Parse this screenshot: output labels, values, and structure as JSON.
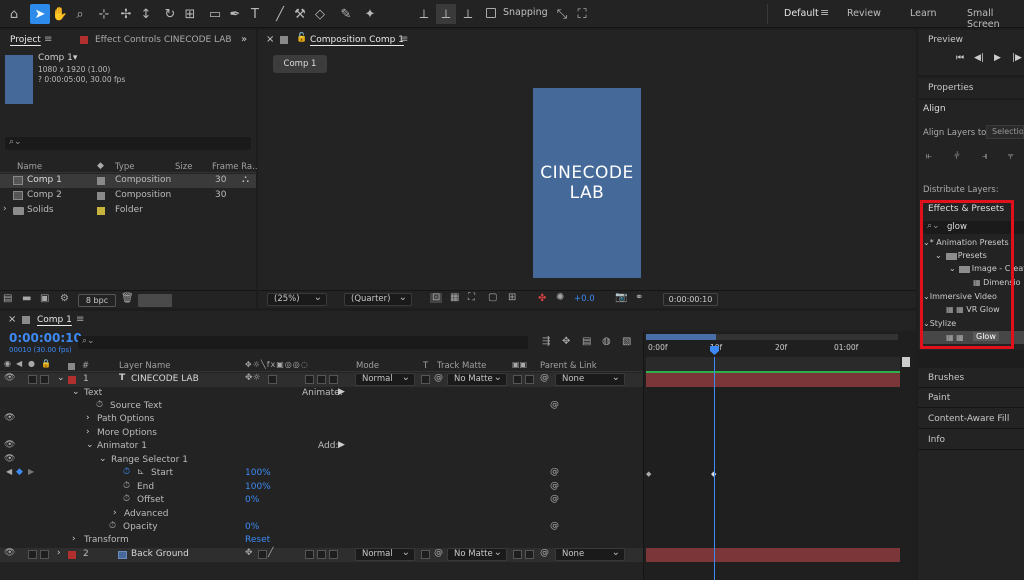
{
  "toolbar": {
    "snapping_label": "Snapping",
    "workspaces": [
      "Default",
      "Review",
      "Learn",
      "Small Screen"
    ]
  },
  "project": {
    "tab_project": "Project",
    "tab_effect_controls": "Effect Controls CINECODE LAB",
    "comp_name": "Comp 1",
    "comp_size": "1080 x 1920 (1.00)",
    "comp_duration": "? 0:00:05:00, 30.00 fps",
    "columns": {
      "name": "Name",
      "type": "Type",
      "size": "Size",
      "frame_rate": "Frame Ra..."
    },
    "items": [
      {
        "name": "Comp 1",
        "type": "Composition",
        "size": "",
        "frame_rate": "30",
        "label_color": "#8a8a8a"
      },
      {
        "name": "Comp 2",
        "type": "Composition",
        "size": "",
        "frame_rate": "30",
        "label_color": "#8a8a8a"
      },
      {
        "name": "Solids",
        "type": "Folder",
        "size": "",
        "frame_rate": "",
        "label_color": "#c8b43c"
      }
    ],
    "bpc": "8 bpc"
  },
  "composition": {
    "tab_label": "Composition Comp 1",
    "crumb": "Comp 1",
    "canvas_text_line1": "CINECODE",
    "canvas_text_line2": "LAB",
    "canvas_color": "#456a99",
    "zoom": "(25%)",
    "quality": "(Quarter)",
    "exposure": "+0.0",
    "timecode": "0:00:00:10"
  },
  "timeline": {
    "tab_label": "Comp 1",
    "current_time": "0:00:00:10",
    "fps_info": "00010 (30.00 fps)",
    "ruler_labels": [
      "0:00f",
      "10f",
      "20f",
      "01:00f"
    ],
    "columns": {
      "num": "#",
      "layer_name": "Layer Name",
      "mode": "Mode",
      "t": "T",
      "track_matte": "Track Matte",
      "parent": "Parent & Link"
    },
    "layers": [
      {
        "num": "1",
        "name": "CINECODE LAB",
        "mode": "Normal",
        "matte": "No Matte",
        "parent": "None"
      },
      {
        "num": "2",
        "name": "Back Ground",
        "mode": "Normal",
        "matte": "No Matte",
        "parent": "None"
      }
    ],
    "props": {
      "text": "Text",
      "animate": "Animate:",
      "source_text": "Source Text",
      "path_options": "Path Options",
      "more_options": "More Options",
      "animator": "Animator 1",
      "add": "Add:",
      "range_selector": "Range Selector 1",
      "start": "Start",
      "start_val": "100%",
      "end": "End",
      "end_val": "100%",
      "offset": "Offset",
      "offset_val": "0%",
      "advanced": "Advanced",
      "opacity": "Opacity",
      "opacity_val": "0%",
      "transform": "Transform",
      "reset": "Reset"
    }
  },
  "right_panel": {
    "preview": "Preview",
    "properties": "Properties",
    "align": "Align",
    "align_layers_to": "Align Layers to:",
    "align_target": "Selectio",
    "distribute": "Distribute Layers:",
    "effects_presets": "Effects & Presets",
    "search_value": "glow",
    "tree": {
      "animation_presets": "* Animation Presets",
      "presets": "Presets",
      "image_creative": "Image - Creat",
      "dimensions": "Dimensio",
      "immersive_video": "Immersive Video",
      "vr_glow": "VR Glow",
      "stylize": "Stylize",
      "glow": "Glow"
    },
    "other_panels": [
      "Brushes",
      "Paint",
      "Content-Aware Fill",
      "Info"
    ],
    "highlight_color": "#e0101c"
  }
}
